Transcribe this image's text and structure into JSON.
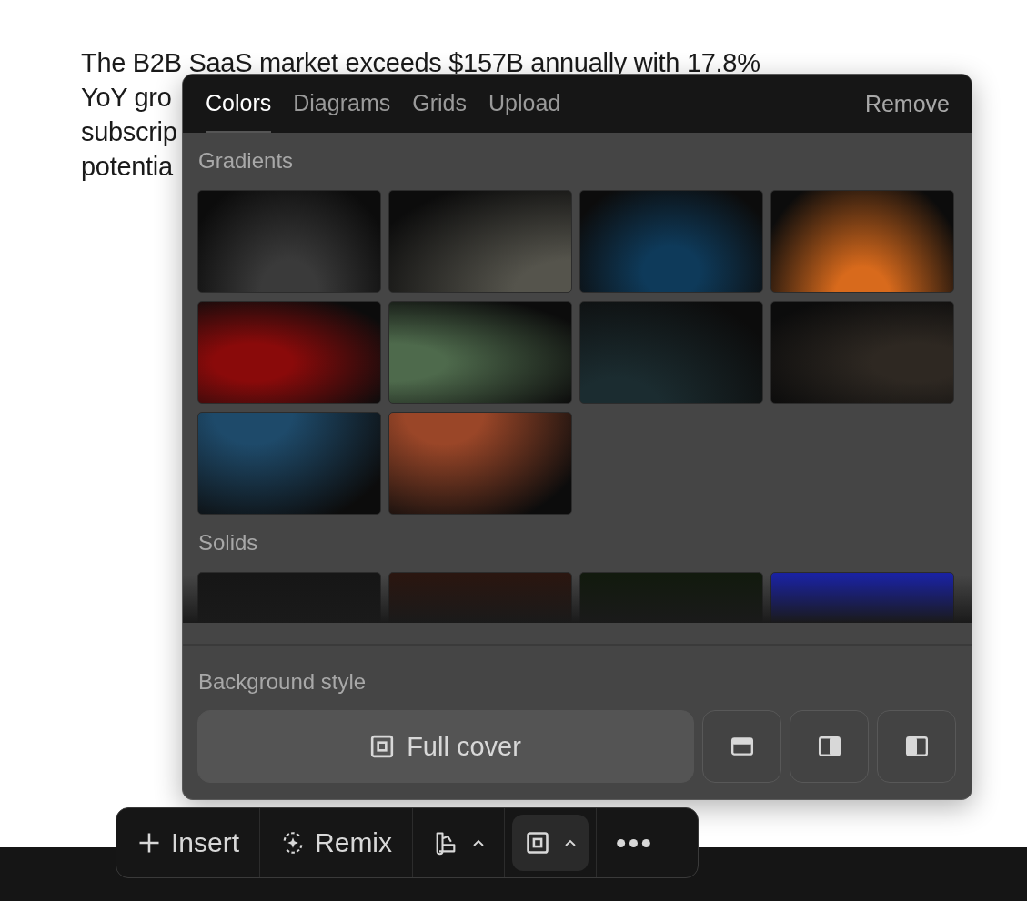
{
  "paragraph_lines": [
    "The B2B SaaS market exceeds $157B annually with 17.8%",
    "YoY gro",
    "subscrip",
    "potentia"
  ],
  "panel": {
    "tabs": [
      {
        "label": "Colors",
        "selected": true
      },
      {
        "label": "Diagrams",
        "selected": false
      },
      {
        "label": "Grids",
        "selected": false
      },
      {
        "label": "Upload",
        "selected": false
      }
    ],
    "remove_label": "Remove",
    "sections": [
      {
        "title": "Gradients",
        "kind": "gradient",
        "swatches": [
          {
            "color": "#3a3a3a"
          },
          {
            "color": "#55544c"
          },
          {
            "color": "#0e3a5a"
          },
          {
            "color": "#d86a1c"
          },
          {
            "color": "#8a0a0a"
          },
          {
            "color": "#4e6a4c"
          },
          {
            "color": "#1b2c30"
          },
          {
            "color": "#2e2822"
          },
          {
            "color": "#1e4a6a"
          },
          {
            "color": "#9a4628"
          }
        ]
      },
      {
        "title": "Solids",
        "kind": "solid",
        "swatches": [
          {
            "color": "#161616"
          },
          {
            "color": "#2a1610"
          },
          {
            "color": "#121a0e"
          },
          {
            "color": "#1a22a0"
          }
        ]
      }
    ],
    "background_style": {
      "title": "Background style",
      "options": [
        {
          "kind": "full",
          "label": "Full cover",
          "selected": true
        },
        {
          "kind": "top",
          "selected": false
        },
        {
          "kind": "right",
          "selected": false
        },
        {
          "kind": "left",
          "selected": false
        }
      ]
    }
  },
  "toolbar": [
    {
      "kind": "insert",
      "label": "Insert",
      "selected": false
    },
    {
      "kind": "remix",
      "label": "Remix",
      "selected": false
    },
    {
      "kind": "theme",
      "selected": false
    },
    {
      "kind": "layout",
      "selected": true
    },
    {
      "kind": "more",
      "selected": false
    }
  ]
}
